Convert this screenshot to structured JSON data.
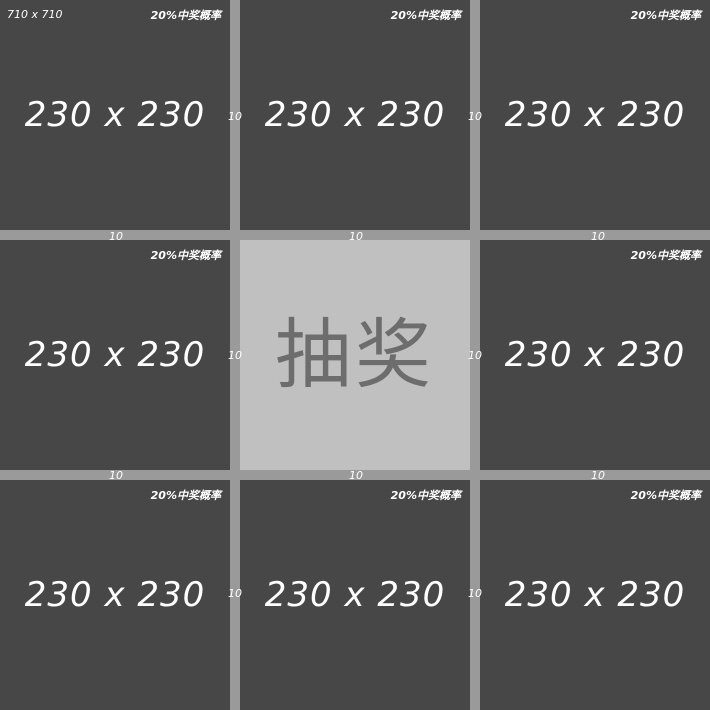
{
  "canvas_size_label": "710 x 710",
  "grid": {
    "cells": [
      {
        "dims": "230 x 230",
        "probability": "20%中奖概率"
      },
      {
        "dims": "230 x 230",
        "probability": "20%中奖概率"
      },
      {
        "dims": "230 x 230",
        "probability": "20%中奖概率"
      },
      {
        "dims": "230 x 230",
        "probability": "20%中奖概率"
      },
      {
        "dims": "230 x 230",
        "probability": "20%中奖概率"
      },
      {
        "dims": "230 x 230",
        "probability": "20%中奖概率"
      },
      {
        "dims": "230 x 230",
        "probability": "20%中奖概率"
      },
      {
        "dims": "230 x 230",
        "probability": "20%中奖概率"
      }
    ],
    "draw_button_label": "抽奖",
    "gap_label": "10"
  },
  "colors": {
    "page_background": "#9a9a9a",
    "cell_background": "#474747",
    "center_background": "#c0c0c0",
    "center_text": "#6d6d6d",
    "text": "#ffffff"
  }
}
